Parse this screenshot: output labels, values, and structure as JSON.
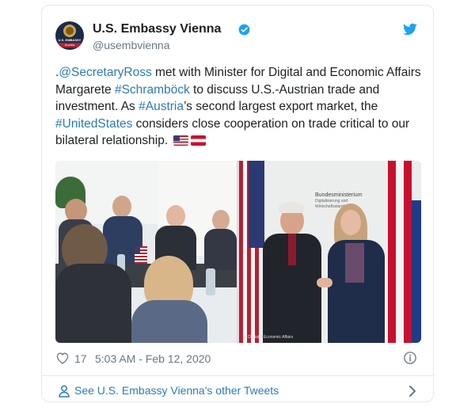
{
  "account": {
    "display_name": "U.S. Embassy Vienna",
    "handle": "@usembvienna",
    "avatar_text": "U.S. EMBASSY",
    "avatar_subtext": "Austria"
  },
  "tweet": {
    "seg1": ".",
    "mention": "@SecretaryRoss",
    "seg2": " met with Minister for Digital and Economic Affairs Margarete ",
    "hashtag1": "#Schramböck",
    "seg3": " to discuss U.S.-Austrian trade and investment. As ",
    "hashtag2": "#Austria",
    "seg4": "’s second largest export market, the ",
    "hashtag3": "#UnitedStates",
    "seg5": " considers close cooperation on trade critical to our bilateral relationship. "
  },
  "media": {
    "sign_line1": "Bundesministerium",
    "sign_line2": "Digitalisierung und",
    "sign_line3": "Wirtschaftsstandort",
    "credit": "© Digital & Economic Affairs"
  },
  "meta": {
    "likes": "17",
    "timestamp": "5:03 AM - Feb 12, 2020"
  },
  "footer": {
    "other_tweets_label": "See U.S. Embassy Vienna's other Tweets"
  },
  "colors": {
    "link": "#2b7bb9",
    "verified": "#1da1f2",
    "twitter_blue": "#1da1f2"
  },
  "icons": [
    "verified-badge-icon",
    "twitter-bird-icon",
    "heart-icon",
    "info-icon",
    "person-icon",
    "chevron-right-icon"
  ]
}
